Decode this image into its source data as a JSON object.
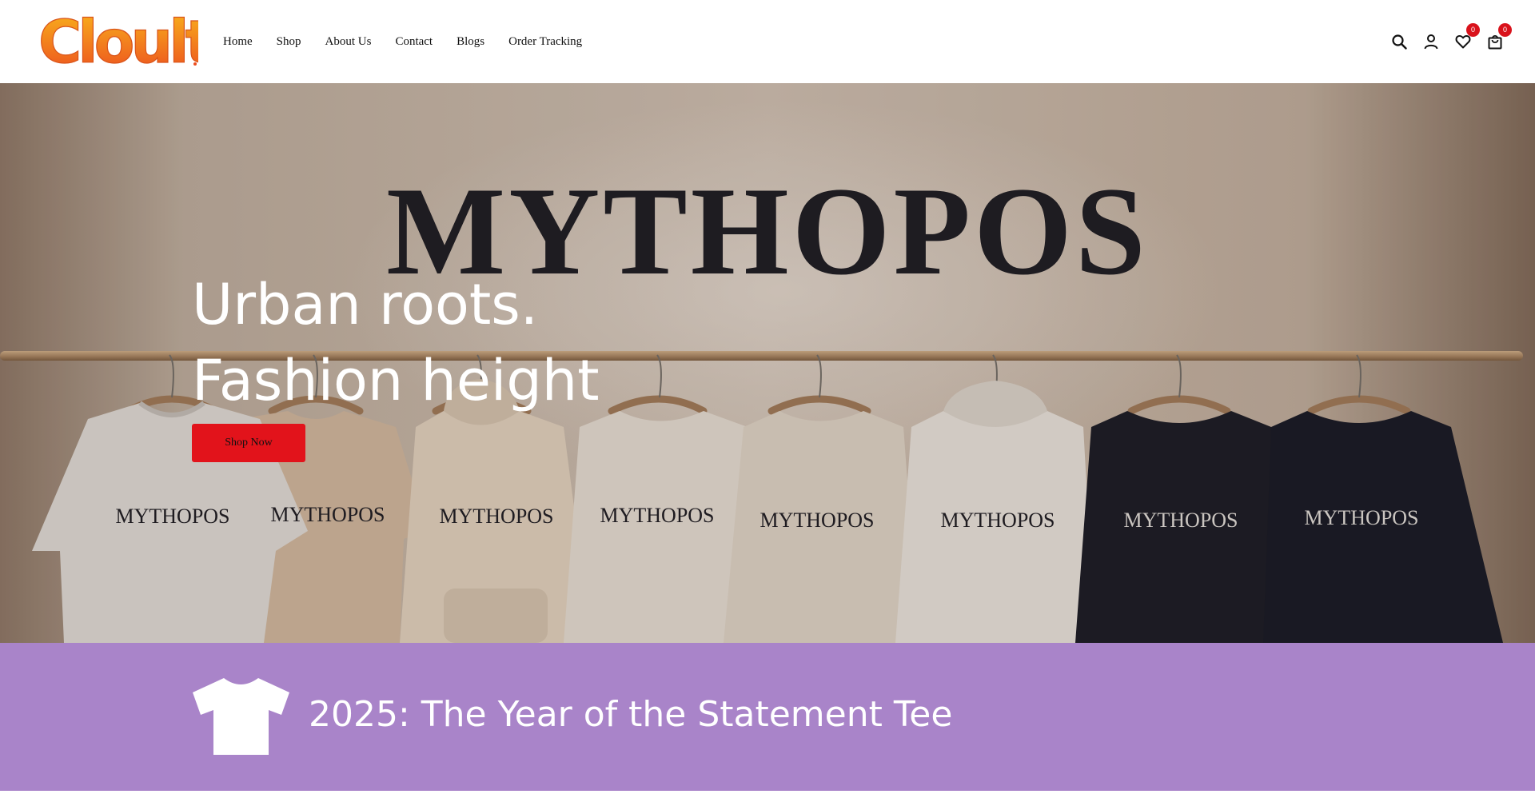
{
  "brand": {
    "logo_text": "Cloult",
    "logo_icon": "cloult-logo",
    "logo_colors": [
      "#f7a21a",
      "#ef5a1f"
    ]
  },
  "nav": {
    "items": [
      {
        "label": "Home"
      },
      {
        "label": "Shop"
      },
      {
        "label": "About Us"
      },
      {
        "label": "Contact"
      },
      {
        "label": "Blogs"
      },
      {
        "label": "Order Tracking"
      }
    ]
  },
  "header_icons": {
    "search": {
      "icon": "search-icon"
    },
    "account": {
      "icon": "user-icon"
    },
    "wishlist": {
      "icon": "heart-icon",
      "count": "0"
    },
    "cart": {
      "icon": "shopping-bag-icon",
      "count": "0"
    }
  },
  "hero": {
    "wall_brand": "MYTHOPOS",
    "garment_label": "MYTHOPOS",
    "title_line1": "Urban roots.",
    "title_line2": "Fashion height",
    "cta_label": "Shop Now",
    "cta_color": "#e2131b"
  },
  "promo": {
    "icon": "tshirt-icon",
    "text": "2025: The Year of the Statement Tee",
    "background": "#a984c9"
  }
}
